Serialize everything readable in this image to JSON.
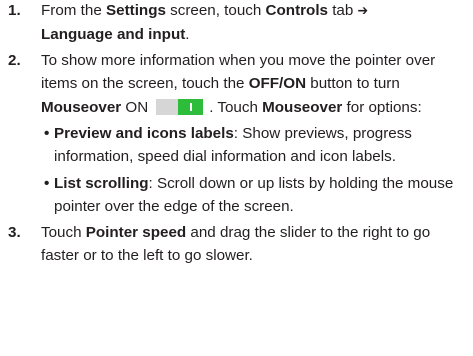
{
  "steps": [
    {
      "number": "1.",
      "t1": "From the ",
      "b1": "Settings",
      "t2": " screen, touch ",
      "b2": "Controls",
      "t3": " tab ",
      "arrow": "➔",
      "b3": "Language and input",
      "t4": "."
    },
    {
      "number": "2.",
      "t1": "To show more information when you move the pointer over items on the screen, touch the ",
      "b1": "OFF/ON",
      "t2": " button to turn ",
      "b2": "Mouseover",
      "t3": " ON",
      "t4": ". Touch ",
      "b3": "Mouseover",
      "t5": " for options:",
      "toggle": {
        "state": "on",
        "off_color": "#d6d6d6",
        "on_color": "#2ebd3b"
      },
      "options": [
        {
          "bullet": "•",
          "title": "Preview and icons labels",
          "desc": ": Show previews, progress information, speed dial information and icon labels."
        },
        {
          "bullet": "•",
          "title": "List scrolling",
          "desc": ": Scroll down or up lists by holding the mouse pointer over the edge of the screen."
        }
      ]
    },
    {
      "number": "3.",
      "t1": "Touch ",
      "b1": "Pointer speed",
      "t2": " and drag the slider to the right to go faster or to the left to go slower."
    }
  ]
}
